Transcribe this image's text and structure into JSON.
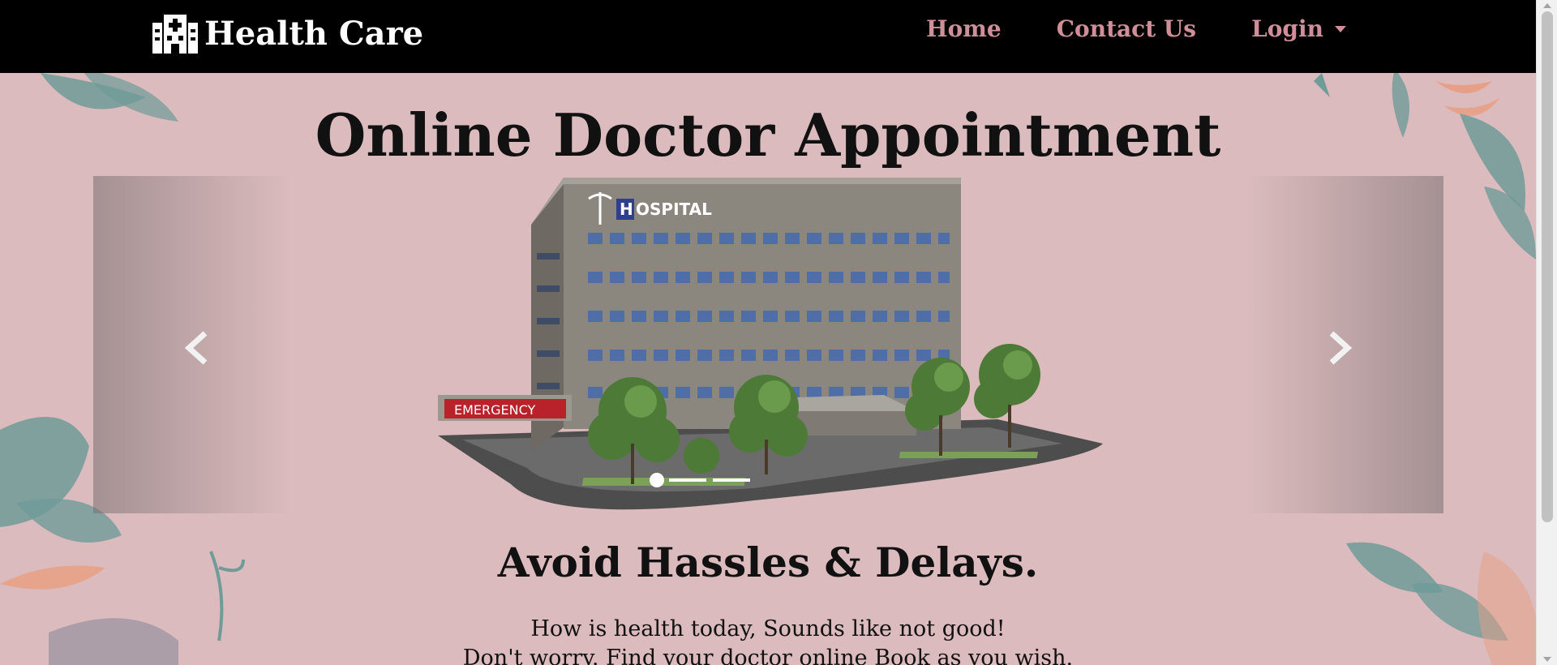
{
  "navbar": {
    "brand_name": "Health Care",
    "brand_icon": "hospital-icon",
    "links": [
      {
        "label": "Home"
      },
      {
        "label": "Contact Us"
      },
      {
        "label": "Login",
        "dropdown": true
      }
    ]
  },
  "hero": {
    "title": "Online Doctor Appointment",
    "carousel": {
      "slide_image": "hospital-building",
      "slide_signs": {
        "hospital": "HOSPITAL",
        "emergency": "EMERGENCY"
      },
      "active_index": 0,
      "slide_count": 3,
      "prev_icon": "chevron-left-icon",
      "next_icon": "chevron-right-icon"
    },
    "subtitle": "Avoid Hassles & Delays.",
    "text_line1": "How is health today, Sounds like not good!",
    "text_line2": "Don't worry. Find your doctor online Book as you wish."
  },
  "colors": {
    "background": "#dbbbbd",
    "navbar": "#000000",
    "nav_link": "#d08f98",
    "leaf_teal": "#6f9b98",
    "leaf_orange": "#e7a085"
  }
}
